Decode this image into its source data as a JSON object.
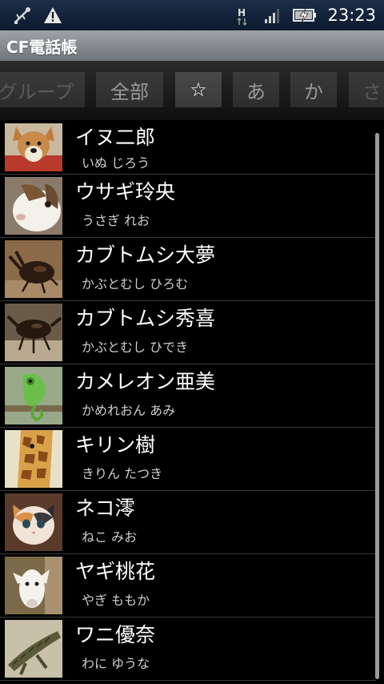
{
  "status_bar": {
    "time": "23:23",
    "network_type": "H",
    "left_icons": [
      "usb-debug-icon",
      "warning-icon"
    ],
    "right_icons": [
      "network-h-icon",
      "signal-icon",
      "battery-charging-icon"
    ]
  },
  "app": {
    "title": "CF電話帳"
  },
  "tabs": [
    {
      "label": "グループ",
      "state": "faded"
    },
    {
      "label": "全部",
      "state": "normal"
    },
    {
      "label": "☆",
      "state": "selected"
    },
    {
      "label": "あ",
      "state": "normal"
    },
    {
      "label": "か",
      "state": "normal"
    },
    {
      "label": "さ",
      "state": "faded"
    }
  ],
  "contacts": [
    {
      "name": "イヌ二郎",
      "reading": "いぬ じろう",
      "animal": "dog"
    },
    {
      "name": "ウサギ玲央",
      "reading": "うさぎ れお",
      "animal": "rabbit"
    },
    {
      "name": "カブトムシ大夢",
      "reading": "かぶとむし ひろむ",
      "animal": "beetle"
    },
    {
      "name": "カブトムシ秀喜",
      "reading": "かぶとむし ひでき",
      "animal": "beetle"
    },
    {
      "name": "カメレオン亜美",
      "reading": "かめれおん あみ",
      "animal": "chameleon"
    },
    {
      "name": "キリン樹",
      "reading": "きりん たつき",
      "animal": "giraffe"
    },
    {
      "name": "ネコ澪",
      "reading": "ねこ みお",
      "animal": "cat"
    },
    {
      "name": "ヤギ桃花",
      "reading": "やぎ ももか",
      "animal": "goat"
    },
    {
      "name": "ワニ優奈",
      "reading": "わに ゆうな",
      "animal": "crocodile"
    }
  ],
  "colors": {
    "status_bar": "#0d1a2e",
    "title_bar": "#8a8f94",
    "list_background": "#000000",
    "divider": "#3a3a3a"
  }
}
